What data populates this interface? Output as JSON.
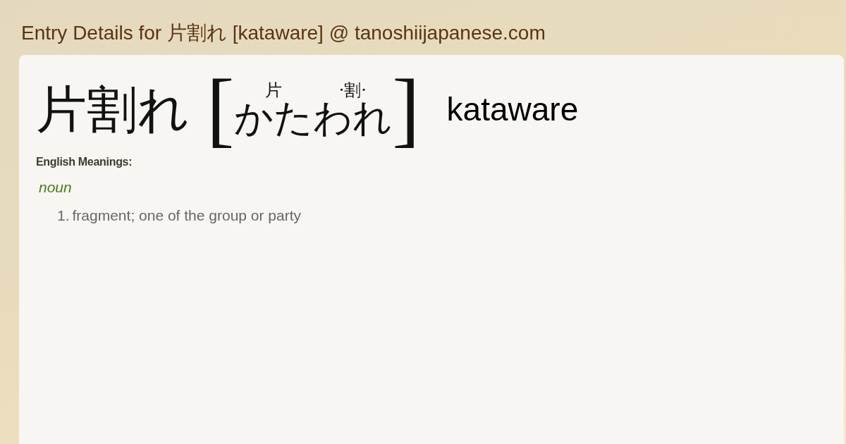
{
  "page_title": "Entry Details for 片割れ [kataware] @ tanoshiijapanese.com",
  "entry": {
    "headword": "片割れ",
    "reading": {
      "open": "[",
      "segments": [
        {
          "ruby": "片",
          "kana": "かた"
        },
        {
          "ruby": "·割·",
          "kana": "われ"
        }
      ],
      "close": "]"
    },
    "romaji": "kataware"
  },
  "meanings": {
    "heading": "English Meanings:",
    "groups": [
      {
        "part_of_speech": "noun",
        "senses": [
          {
            "number": "1.",
            "text": "fragment; one of the group or party"
          }
        ]
      }
    ]
  }
}
